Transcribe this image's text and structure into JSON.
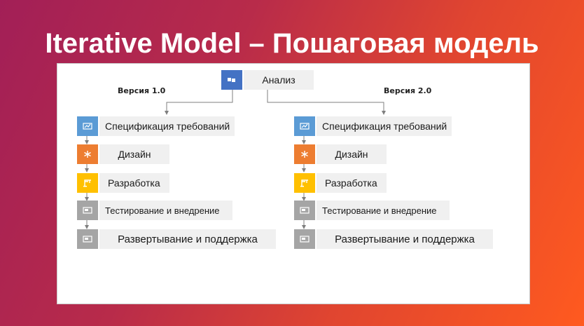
{
  "title": "Iterative Model – Пошаговая модель",
  "root": {
    "label": "Анализ",
    "icon": "flag-icon",
    "color": "#4472c4"
  },
  "versions": [
    {
      "label": "Версия 1.0"
    },
    {
      "label": "Версия 2.0"
    }
  ],
  "steps": [
    {
      "label": "Спецификация требований",
      "icon": "chart-icon",
      "color": "#5b9bd5"
    },
    {
      "label": "Дизайн",
      "icon": "asterisk-icon",
      "color": "#ed7d31"
    },
    {
      "label": "Разработка",
      "icon": "crane-icon",
      "color": "#ffc000"
    },
    {
      "label": "Тестирование и внедрение",
      "icon": "screen-icon",
      "color": "#a5a5a5"
    },
    {
      "label": "Развертывание и поддержка",
      "icon": "screen-icon",
      "color": "#a5a5a5"
    }
  ],
  "colors": {
    "background_start": "#a21f57",
    "background_end": "#ff5a1f",
    "label_bg": "#f0f0f0",
    "connector": "#7f7f7f"
  }
}
